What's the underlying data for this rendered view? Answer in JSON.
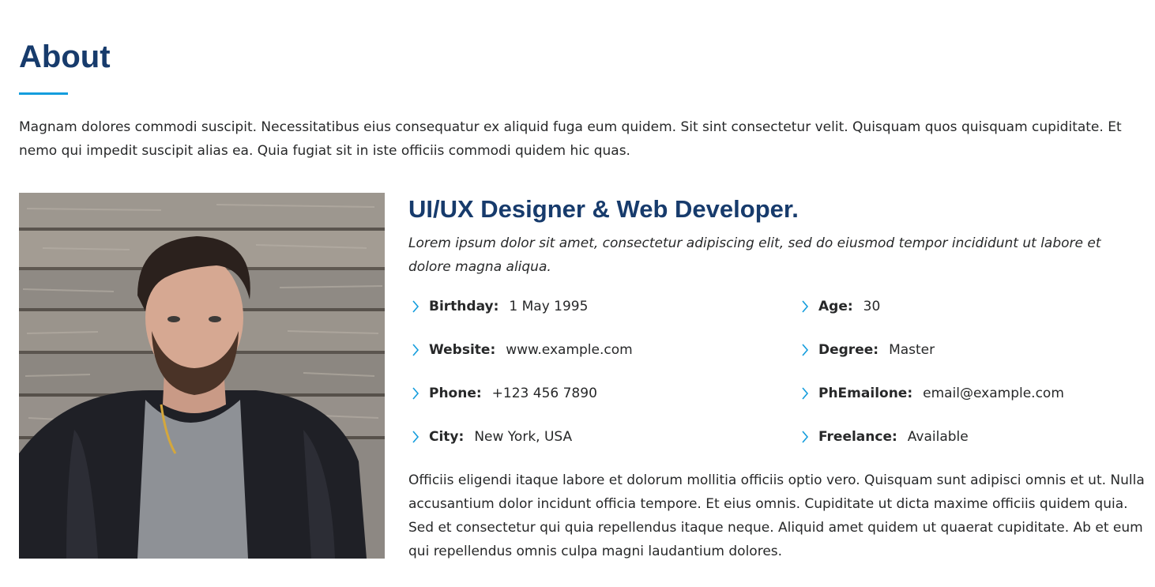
{
  "section": {
    "title": "About",
    "intro": "Magnam dolores commodi suscipit. Necessitatibus eius consequatur ex aliquid fuga eum quidem. Sit sint consectetur velit. Quisquam quos quisquam cupiditate. Et nemo qui impedit suscipit alias ea. Quia fugiat sit in iste officiis commodi quidem hic quas."
  },
  "profile": {
    "photo_alt": "Profile photo of a young bearded man in a dark jacket in front of a weathered wooden wall",
    "role": "UI/UX Designer & Web Developer.",
    "description": "Lorem ipsum dolor sit amet, consectetur adipiscing elit, sed do eiusmod tempor incididunt ut labore et dolore magna aliqua.",
    "info_left": [
      {
        "label": "Birthday:",
        "value": "1 May 1995"
      },
      {
        "label": "Website:",
        "value": "www.example.com"
      },
      {
        "label": "Phone:",
        "value": "+123 456 7890"
      },
      {
        "label": "City:",
        "value": "New York, USA"
      }
    ],
    "info_right": [
      {
        "label": "Age:",
        "value": "30"
      },
      {
        "label": "Degree:",
        "value": "Master"
      },
      {
        "label": "PhEmailone:",
        "value": "email@example.com"
      },
      {
        "label": "Freelance:",
        "value": "Available"
      }
    ],
    "outro": "Officiis eligendi itaque labore et dolorum mollitia officiis optio vero. Quisquam sunt adipisci omnis et ut. Nulla accusantium dolor incidunt officia tempore. Et eius omnis. Cupiditate ut dicta maxime officiis quidem quia. Sed et consectetur qui quia repellendus itaque neque. Aliquid amet quidem ut quaerat cupiditate. Ab et eum qui repellendus omnis culpa magni laudantium dolores."
  },
  "colors": {
    "heading": "#173b6c",
    "accent": "#149ddd",
    "text": "#272829"
  },
  "icons": {
    "list_bullet": "chevron-right-icon"
  }
}
